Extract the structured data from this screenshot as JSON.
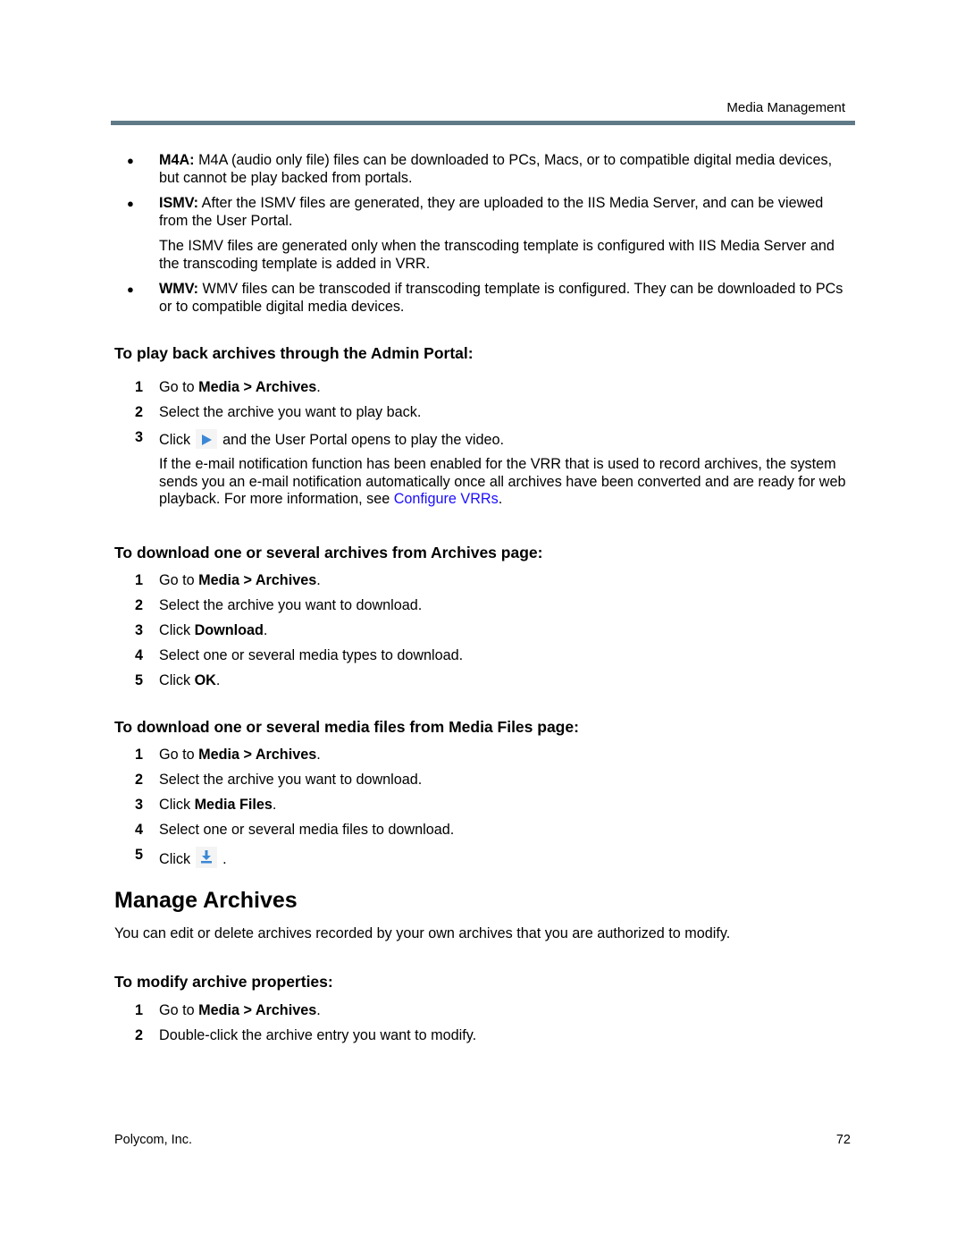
{
  "header": {
    "running_title": "Media Management",
    "rule_color": "#5f7a86"
  },
  "bullets": [
    {
      "term": "M4A:",
      "text": " M4A (audio only file) files can be downloaded to PCs, Macs, or to compatible digital media devices, but cannot be play backed from portals."
    },
    {
      "term": "ISMV:",
      "text": " After the ISMV files are generated, they are uploaded to the IIS Media Server, and can be viewed from the User Portal.",
      "subtext": "The ISMV files are generated only when the transcoding template is configured with IIS Media Server and the transcoding template is added in VRR."
    },
    {
      "term": "WMV:",
      "text": " WMV files can be transcoded if transcoding template is configured. They can be downloaded to PCs or to compatible digital media devices."
    }
  ],
  "procedures": {
    "playback": {
      "heading": "To play back archives through the Admin Portal:",
      "steps": [
        {
          "num": "1",
          "pre": "Go to ",
          "bold": "Media > Archives",
          "post": "."
        },
        {
          "num": "2",
          "pre": "Select the archive you want to play back.",
          "bold": "",
          "post": ""
        },
        {
          "num": "3",
          "pre": "Click",
          "icon": "play-icon",
          "post": "and the User Portal opens to play the video."
        }
      ],
      "note_pre": "If the e-mail notification function has been enabled for the VRR that is used to record archives, the system sends you an e-mail notification automatically once all archives have been converted and are ready for web playback. For more information, see ",
      "note_link": "Configure VRRs",
      "note_post": ".",
      "link_color": "#1a0dff"
    },
    "download_archives": {
      "heading": "To download one or several archives from Archives page:",
      "steps": [
        {
          "num": "1",
          "pre": "Go to ",
          "bold": "Media > Archives",
          "post": "."
        },
        {
          "num": "2",
          "pre": "Select the archive you want to download.",
          "bold": "",
          "post": ""
        },
        {
          "num": "3",
          "pre": "Click ",
          "bold": "Download",
          "post": "."
        },
        {
          "num": "4",
          "pre": "Select one or several media types to download.",
          "bold": "",
          "post": ""
        },
        {
          "num": "5",
          "pre": "Click ",
          "bold": "OK",
          "post": "."
        }
      ]
    },
    "download_media_files": {
      "heading": "To download one or several media files from Media Files page:",
      "steps": [
        {
          "num": "1",
          "pre": "Go to ",
          "bold": "Media > Archives",
          "post": "."
        },
        {
          "num": "2",
          "pre": "Select the archive you want to download.",
          "bold": "",
          "post": ""
        },
        {
          "num": "3",
          "pre": "Click ",
          "bold": "Media Files",
          "post": "."
        },
        {
          "num": "4",
          "pre": "Select one or several media files to download.",
          "bold": "",
          "post": ""
        },
        {
          "num": "5",
          "pre": "Click",
          "icon": "download-icon",
          "post": "."
        }
      ]
    }
  },
  "manage": {
    "title": "Manage Archives",
    "intro": "You can edit or delete archives recorded by your own archives that you are authorized to modify.",
    "modify": {
      "heading": "To modify archive properties:",
      "steps": [
        {
          "num": "1",
          "pre": "Go to ",
          "bold": "Media > Archives",
          "post": "."
        },
        {
          "num": "2",
          "pre": "Double-click the archive entry you want to modify.",
          "bold": "",
          "post": ""
        }
      ]
    }
  },
  "footer": {
    "company": "Polycom, Inc.",
    "page_number": "72"
  }
}
